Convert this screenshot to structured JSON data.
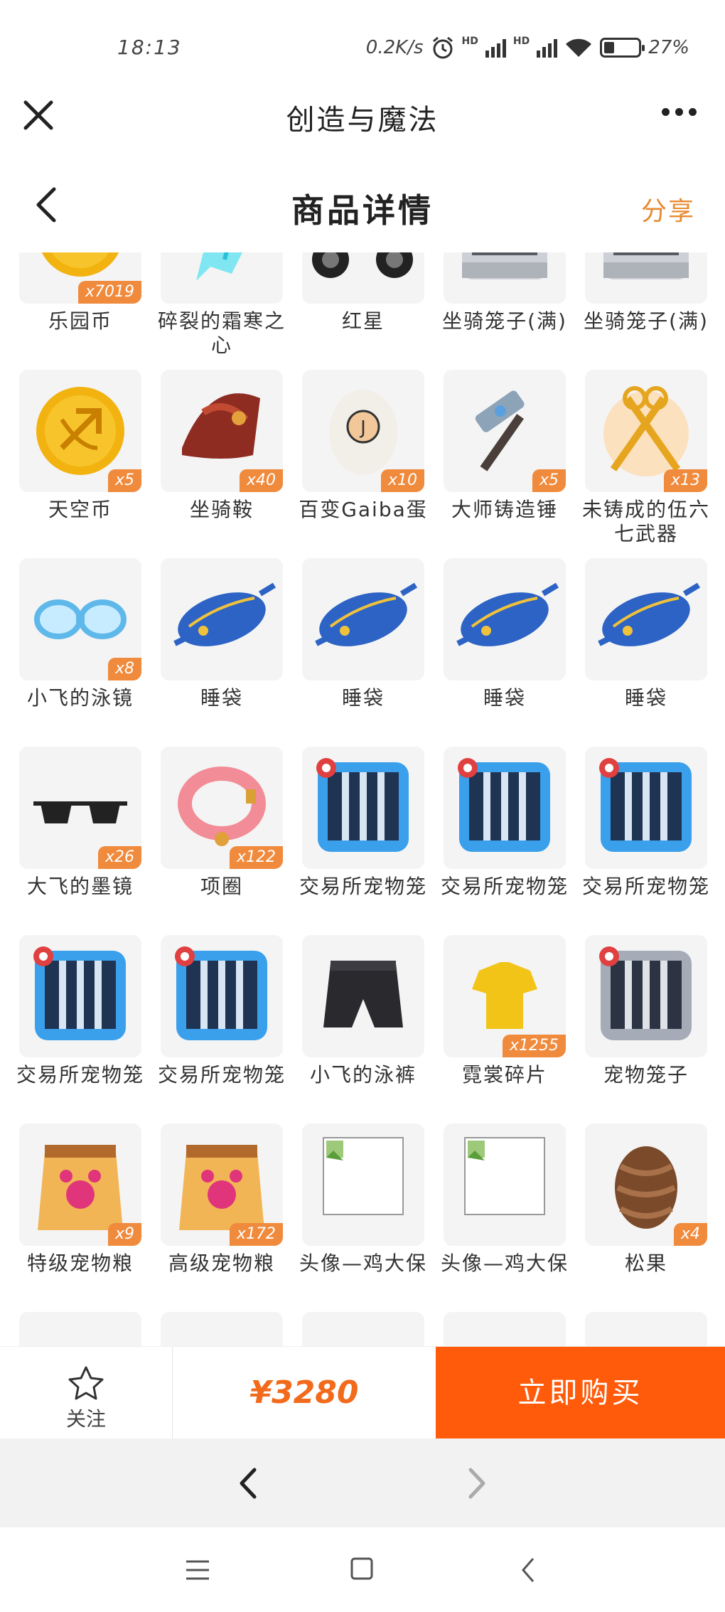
{
  "status": {
    "time": "18:13",
    "speed": "0.2K/s",
    "hd1": "HD",
    "hd2": "HD",
    "battery": "27%"
  },
  "app": {
    "title": "创造与魔法"
  },
  "page": {
    "title": "商品详情",
    "share_label": "分享"
  },
  "items": [
    {
      "name": "乐园币",
      "qty": "x7019",
      "icon": "paradise-coin-icon"
    },
    {
      "name": "碎裂的霜寒之心",
      "qty": "",
      "icon": "frost-heart-icon"
    },
    {
      "name": "红星",
      "qty": "",
      "icon": "motorcycle-icon"
    },
    {
      "name": "坐骑笼子(满)",
      "qty": "",
      "icon": "mount-cage-icon"
    },
    {
      "name": "坐骑笼子(满)",
      "qty": "",
      "icon": "mount-cage-icon"
    },
    {
      "name": "天空币",
      "qty": "x5",
      "icon": "sky-coin-icon"
    },
    {
      "name": "坐骑鞍",
      "qty": "x40",
      "icon": "saddle-icon"
    },
    {
      "name": "百变Gaiba蛋",
      "qty": "x10",
      "icon": "egg-icon"
    },
    {
      "name": "大师铸造锤",
      "qty": "x5",
      "icon": "hammer-icon"
    },
    {
      "name": "未铸成的伍六七武器",
      "qty": "x13",
      "icon": "scissors-icon"
    },
    {
      "name": "小飞的泳镜",
      "qty": "x8",
      "icon": "goggles-icon"
    },
    {
      "name": "睡袋",
      "qty": "",
      "icon": "sleeping-bag-icon"
    },
    {
      "name": "睡袋",
      "qty": "",
      "icon": "sleeping-bag-icon"
    },
    {
      "name": "睡袋",
      "qty": "",
      "icon": "sleeping-bag-icon"
    },
    {
      "name": "睡袋",
      "qty": "",
      "icon": "sleeping-bag-icon"
    },
    {
      "name": "大飞的墨镜",
      "qty": "x26",
      "icon": "sunglasses-icon"
    },
    {
      "name": "项圈",
      "qty": "x122",
      "icon": "collar-icon"
    },
    {
      "name": "交易所宠物笼",
      "qty": "",
      "icon": "pet-cage-blue-icon"
    },
    {
      "name": "交易所宠物笼",
      "qty": "",
      "icon": "pet-cage-blue-icon"
    },
    {
      "name": "交易所宠物笼",
      "qty": "",
      "icon": "pet-cage-blue-icon"
    },
    {
      "name": "交易所宠物笼",
      "qty": "",
      "icon": "pet-cage-blue-icon"
    },
    {
      "name": "交易所宠物笼",
      "qty": "",
      "icon": "pet-cage-blue-icon"
    },
    {
      "name": "小飞的泳裤",
      "qty": "",
      "icon": "swim-shorts-icon"
    },
    {
      "name": "霓裳碎片",
      "qty": "x1255",
      "icon": "shirt-fragment-icon"
    },
    {
      "name": "宠物笼子",
      "qty": "",
      "icon": "pet-cage-grey-icon"
    },
    {
      "name": "特级宠物粮",
      "qty": "x9",
      "icon": "pet-food-bag-icon"
    },
    {
      "name": "高级宠物粮",
      "qty": "x172",
      "icon": "pet-food-bag-icon"
    },
    {
      "name": "头像—鸡大保",
      "qty": "",
      "icon": "broken-image-icon"
    },
    {
      "name": "头像—鸡大保",
      "qty": "",
      "icon": "broken-image-icon"
    },
    {
      "name": "松果",
      "qty": "x4",
      "icon": "pinecone-icon"
    },
    {
      "name": "",
      "qty": "",
      "icon": ""
    },
    {
      "name": "",
      "qty": "",
      "icon": ""
    },
    {
      "name": "",
      "qty": "",
      "icon": ""
    },
    {
      "name": "",
      "qty": "",
      "icon": ""
    },
    {
      "name": "",
      "qty": "",
      "icon": ""
    }
  ],
  "buy_bar": {
    "fav_label": "关注",
    "price": "¥3280",
    "buy_label": "立即购买"
  },
  "colors": {
    "accent": "#ff5b0a",
    "price": "#f26a1b",
    "badge": "#f08a3c",
    "share": "#e88a30"
  }
}
